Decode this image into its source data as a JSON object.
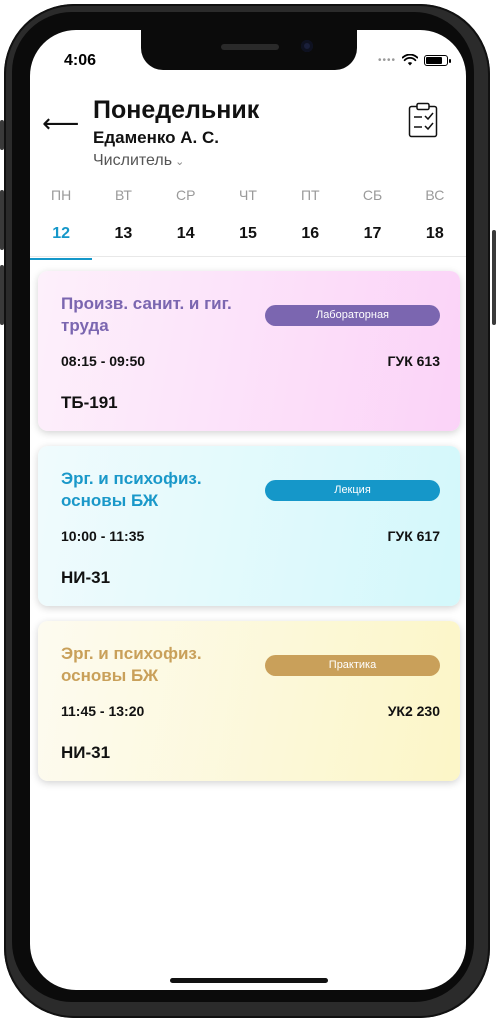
{
  "status_bar": {
    "time": "4:06",
    "battery_level": 0.9
  },
  "header": {
    "day_title": "Понедельник",
    "teacher": "Едаменко А. С.",
    "week_type": "Числитель"
  },
  "days": [
    {
      "name": "ПН",
      "date": "12",
      "active": true
    },
    {
      "name": "ВТ",
      "date": "13"
    },
    {
      "name": "СР",
      "date": "14"
    },
    {
      "name": "ЧТ",
      "date": "15"
    },
    {
      "name": "ПТ",
      "date": "16"
    },
    {
      "name": "СБ",
      "date": "17"
    },
    {
      "name": "ВС",
      "date": "18"
    }
  ],
  "lessons": [
    {
      "subject": "Произв. санит. и гиг. труда",
      "type": "Лабораторная",
      "time": "08:15 - 09:50",
      "room": "ГУК 613",
      "group": "ТБ-191",
      "color": "#7b66b0"
    },
    {
      "subject": "Эрг. и психофиз. основы БЖ",
      "type": "Лекция",
      "time": "10:00 - 11:35",
      "room": "ГУК 617",
      "group": "НИ-31",
      "color": "#1597c9"
    },
    {
      "subject": "Эрг. и психофиз. основы БЖ",
      "type": "Практика",
      "time": "11:45 - 13:20",
      "room": "УК2 230",
      "group": "НИ-31",
      "color": "#c9a05a"
    }
  ]
}
